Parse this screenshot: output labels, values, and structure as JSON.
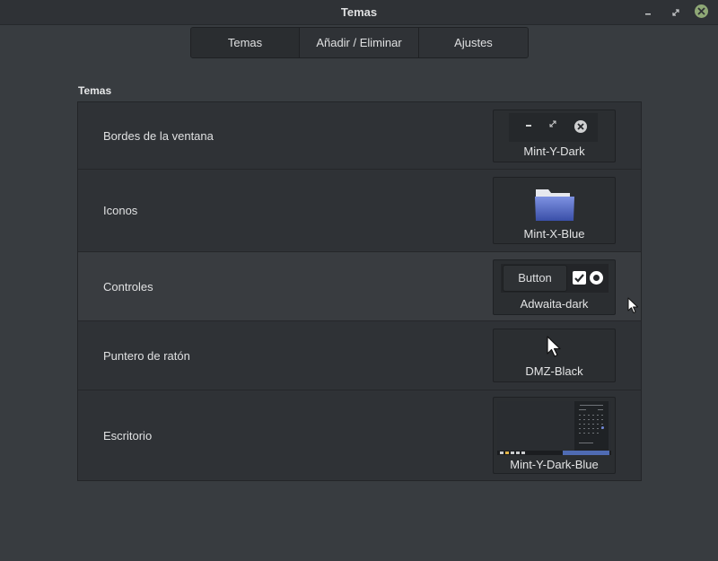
{
  "window": {
    "title": "Temas",
    "controls": [
      "minimize-icon",
      "maximize-icon",
      "close-icon"
    ],
    "close_color": "#8fa876"
  },
  "tabs": [
    {
      "label": "Temas",
      "active": true
    },
    {
      "label": "Añadir / Eliminar",
      "active": false
    },
    {
      "label": "Ajustes",
      "active": false
    }
  ],
  "section": {
    "title": "Temas"
  },
  "rows": [
    {
      "label": "Bordes de la ventana",
      "value": "Mint-Y-Dark"
    },
    {
      "label": "Iconos",
      "value": "Mint-X-Blue"
    },
    {
      "label": "Controles",
      "value": "Adwaita-dark",
      "preview_button": "Button"
    },
    {
      "label": "Puntero de ratón",
      "value": "DMZ-Black"
    },
    {
      "label": "Escritorio",
      "value": "Mint-Y-Dark-Blue"
    }
  ],
  "colors": {
    "background": "#383c40",
    "panel": "#2f3236",
    "highlight_row": "#393c40",
    "accent_blue": "#4f6bb3"
  }
}
